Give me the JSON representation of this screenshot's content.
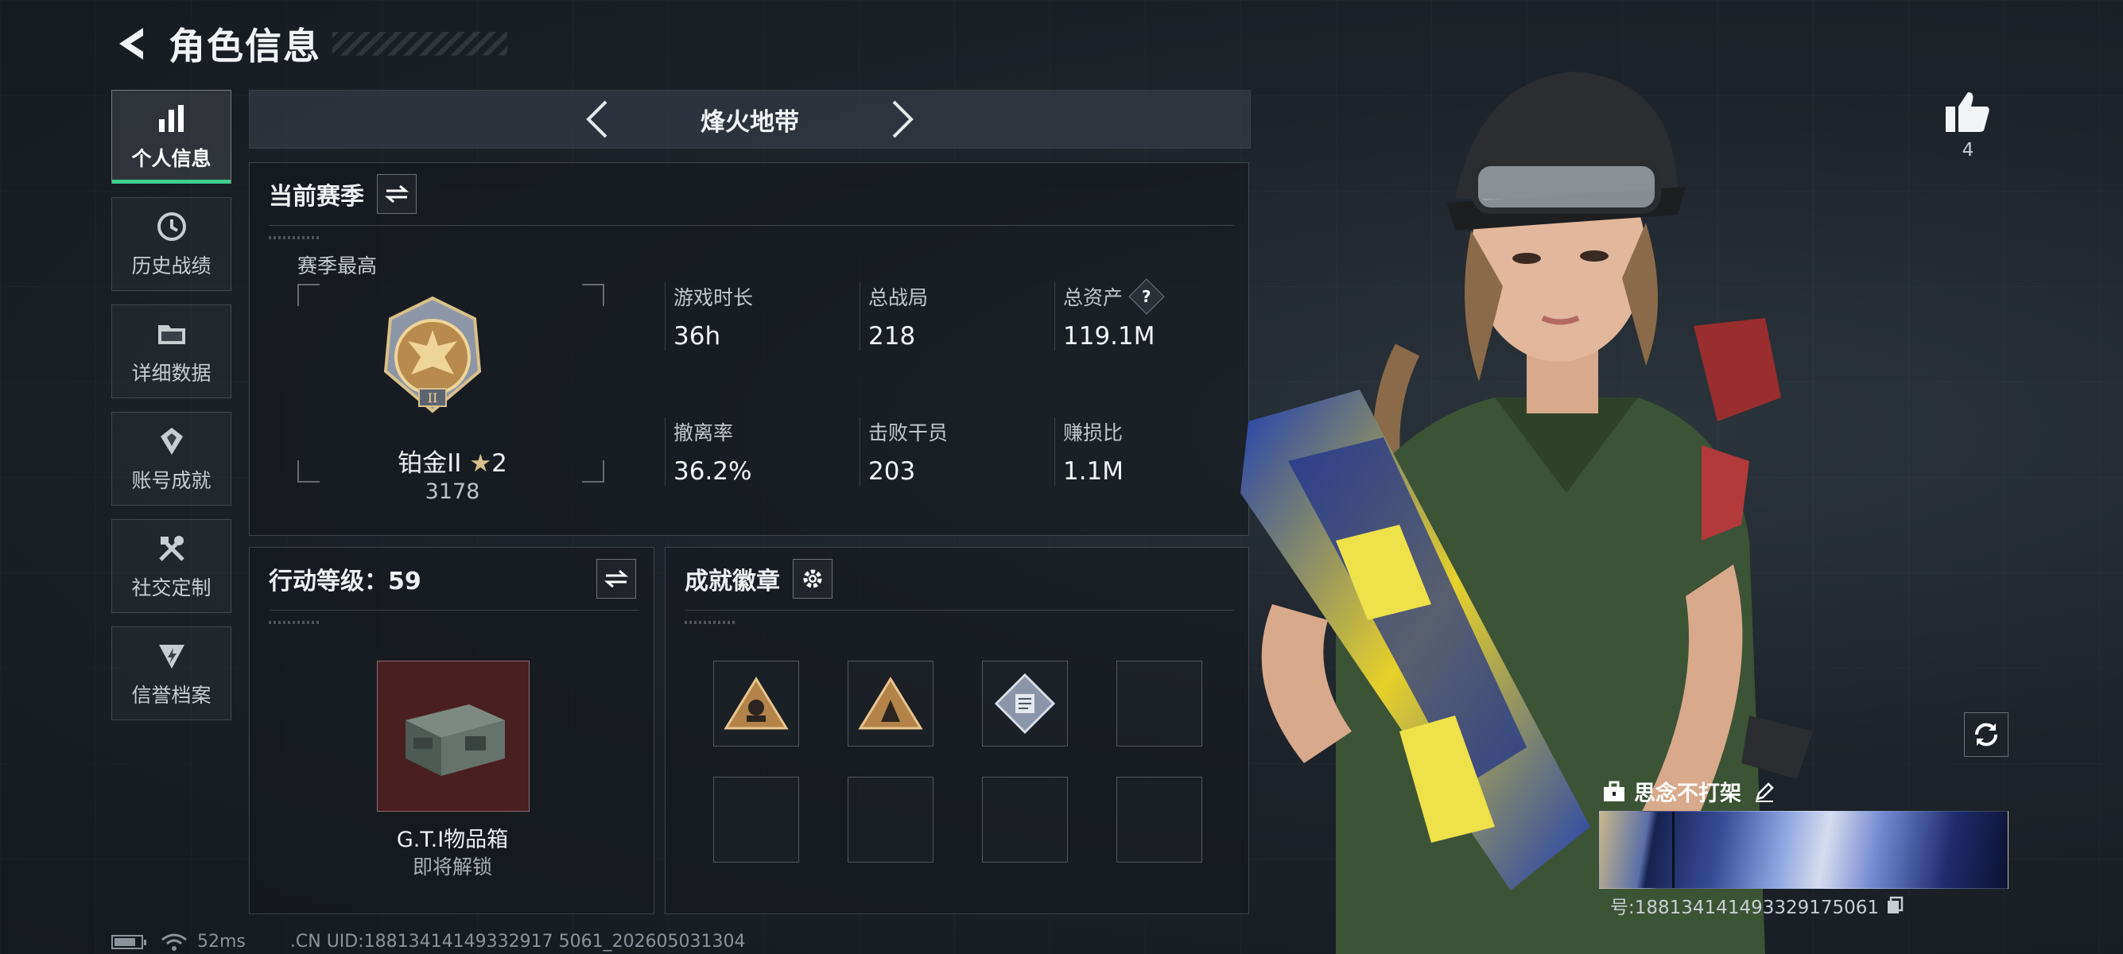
{
  "header": {
    "title": "角色信息"
  },
  "sidebar": {
    "items": [
      {
        "label": "个人信息",
        "icon": "bar-chart-icon",
        "active": true
      },
      {
        "label": "历史战绩",
        "icon": "history-icon",
        "active": false
      },
      {
        "label": "详细数据",
        "icon": "folder-icon",
        "active": false
      },
      {
        "label": "账号成就",
        "icon": "achievement-icon",
        "active": false
      },
      {
        "label": "社交定制",
        "icon": "tools-icon",
        "active": false
      },
      {
        "label": "信誉档案",
        "icon": "credit-icon",
        "active": false
      }
    ]
  },
  "mode": {
    "title": "烽火地带"
  },
  "season": {
    "title": "当前赛季",
    "best_label": "赛季最高",
    "rank_name": "铂金II",
    "rank_stars": "2",
    "rank_score": "3178",
    "stats": [
      {
        "label": "游戏时长",
        "value": "36h"
      },
      {
        "label": "总战局",
        "value": "218"
      },
      {
        "label": "总资产",
        "value": "119.1M",
        "help": "?"
      },
      {
        "label": "撤离率",
        "value": "36.2%"
      },
      {
        "label": "击败干员",
        "value": "203"
      },
      {
        "label": "赚损比",
        "value": "1.1M"
      }
    ]
  },
  "action_level": {
    "title": "行动等级：59",
    "reward_name": "G.T.I物品箱",
    "reward_status": "即将解锁"
  },
  "achievements": {
    "title": "成就徽章",
    "badges": [
      "pyramid-badge",
      "pyramid-badge",
      "diamond-badge",
      "",
      "",
      "",
      "",
      ""
    ]
  },
  "profile": {
    "likes": "4",
    "player_name": "思念不打架",
    "uid_line": "号:1881341414933291750​61"
  },
  "footer": {
    "ping": "52ms",
    "uid": ".CN UID:18813414149332917 5061_202605031304"
  },
  "colors": {
    "accent": "#3ecf8e",
    "reward_bg": "#4a1f21"
  }
}
